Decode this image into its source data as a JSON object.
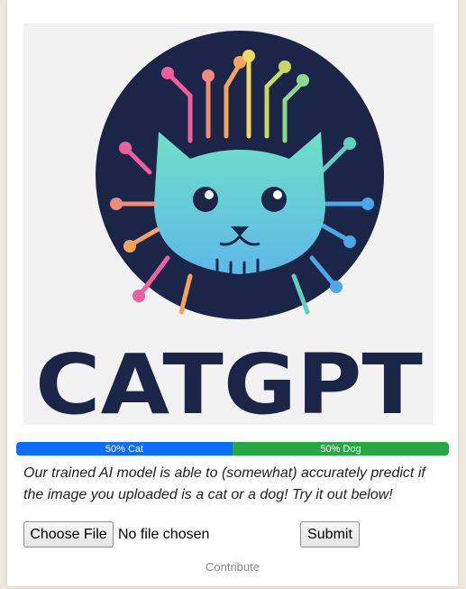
{
  "logo": {
    "wordmark": "CATGPT",
    "colors": {
      "background": "#f2f2f2",
      "circle": "#1a2548",
      "wordmark": "#1a2548",
      "cat_face_top": "#6ee0c8",
      "cat_face_bottom": "#5fb8e8",
      "circuit_pink": "#ef5fa0",
      "circuit_orange": "#f7a35c",
      "circuit_yellow": "#f4d860",
      "circuit_teal": "#5ed0c0",
      "circuit_blue": "#4aa8e8"
    }
  },
  "prediction": {
    "cat_label": "50% Cat",
    "dog_label": "50% Dog",
    "cat_fraction": 0.5,
    "dog_fraction": 0.5,
    "cat_color": "#0d6efd",
    "dog_color": "#28a745"
  },
  "description": "Our trained AI model is able to (somewhat) accurately predict if the image you uploaded is a cat or a dog! Try it out below!",
  "form": {
    "file_button_label": "Choose File",
    "file_status": "No file chosen",
    "submit_label": "Submit"
  },
  "footer": {
    "contribute_label": "Contribute"
  }
}
